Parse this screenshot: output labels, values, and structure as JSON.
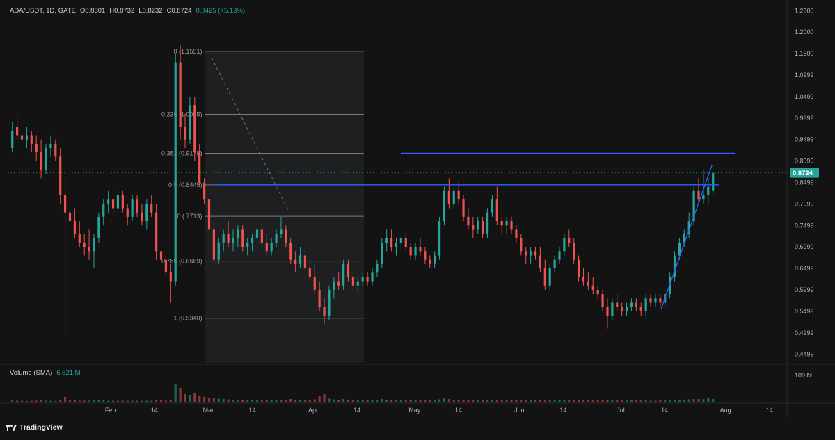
{
  "header": {
    "symbol": "ADA/USDT, 1D, GATE",
    "open": "O0.8301",
    "high": "H0.8732",
    "low": "L0.8232",
    "close": "C0.8724",
    "change": "0.0425 (+5.13%)"
  },
  "volume_panel": {
    "title": "Volume (SMA)",
    "value": "6.621 M",
    "axis_label": "100 M"
  },
  "brand": "TradingView",
  "colors": {
    "up": "#26a69a",
    "down": "#ef5350",
    "line": "#2962ff",
    "fib": "#7a7a7a",
    "badge": "#26a69a"
  },
  "chart_data": {
    "type": "candlestick",
    "price_axis_ticks": [
      "1.2500",
      "1.2000",
      "1.1500",
      "1.0999",
      "1.0499",
      "0.9999",
      "0.9499",
      "0.8999",
      "0.8499",
      "0.7999",
      "0.7499",
      "0.6999",
      "0.6499",
      "0.5999",
      "0.5499",
      "0.4999",
      "0.4499"
    ],
    "ylim": [
      0.43,
      1.265
    ],
    "time_axis_ticks": [
      "Feb",
      "14",
      "Mar",
      "14",
      "Apr",
      "14",
      "May",
      "14",
      "Jun",
      "14",
      "Jul",
      "14",
      "Aug",
      "14"
    ],
    "time_axis_days": [
      31,
      44,
      60,
      73,
      91,
      104,
      121,
      134,
      152,
      165,
      182,
      195,
      213,
      226
    ],
    "xlim": [
      0,
      231
    ],
    "last_price": "0.8724",
    "last_price_value": 0.8724,
    "fib_levels": [
      {
        "label": "0 (1.1551)",
        "value": 1.1551
      },
      {
        "label": "0.236 (1.0085)",
        "value": 1.0085
      },
      {
        "label": "0.382 (0.9178)",
        "value": 0.9178
      },
      {
        "label": "0.5 (0.8445)",
        "value": 0.8445
      },
      {
        "label": "0.(.7713)",
        "value": 0.7713
      },
      {
        "label": "0.786 (0.6669)",
        "value": 0.6669
      },
      {
        "label": "1 (0.5340)",
        "value": 0.534
      }
    ],
    "fib_range_days": [
      59,
      106
    ],
    "fib_diagonal": {
      "from": [
        61,
        1.14
      ],
      "to": [
        84,
        0.78
      ]
    },
    "trend_lines": [
      {
        "from": [
          62,
          0.8445
        ],
        "to": [
          211,
          0.8445
        ]
      },
      {
        "from": [
          117,
          0.918
        ],
        "to": [
          216,
          0.918
        ]
      },
      {
        "from": [
          194,
          0.556
        ],
        "to": [
          209,
          0.89
        ]
      }
    ],
    "ohlc": [
      [
        0.93,
        0.99,
        0.92,
        0.97
      ],
      [
        0.98,
        1.01,
        0.95,
        0.96
      ],
      [
        0.96,
        0.99,
        0.94,
        0.95
      ],
      [
        0.95,
        0.98,
        0.93,
        0.96
      ],
      [
        0.96,
        0.97,
        0.92,
        0.94
      ],
      [
        0.94,
        0.96,
        0.9,
        0.92
      ],
      [
        0.92,
        0.95,
        0.86,
        0.88
      ],
      [
        0.88,
        0.94,
        0.87,
        0.93
      ],
      [
        0.93,
        0.96,
        0.91,
        0.94
      ],
      [
        0.94,
        0.95,
        0.9,
        0.91
      ],
      [
        0.91,
        0.93,
        0.8,
        0.82
      ],
      [
        0.82,
        0.86,
        0.5,
        0.78
      ],
      [
        0.78,
        0.83,
        0.74,
        0.76
      ],
      [
        0.76,
        0.79,
        0.72,
        0.73
      ],
      [
        0.73,
        0.76,
        0.7,
        0.71
      ],
      [
        0.71,
        0.73,
        0.68,
        0.7
      ],
      [
        0.7,
        0.74,
        0.67,
        0.69
      ],
      [
        0.69,
        0.73,
        0.65,
        0.72
      ],
      [
        0.72,
        0.78,
        0.71,
        0.77
      ],
      [
        0.77,
        0.81,
        0.75,
        0.8
      ],
      [
        0.8,
        0.83,
        0.78,
        0.81
      ],
      [
        0.81,
        0.82,
        0.77,
        0.79
      ],
      [
        0.79,
        0.83,
        0.78,
        0.82
      ],
      [
        0.82,
        0.83,
        0.78,
        0.79
      ],
      [
        0.79,
        0.8,
        0.75,
        0.77
      ],
      [
        0.77,
        0.82,
        0.76,
        0.81
      ],
      [
        0.81,
        0.82,
        0.77,
        0.78
      ],
      [
        0.78,
        0.8,
        0.75,
        0.76
      ],
      [
        0.76,
        0.81,
        0.74,
        0.8
      ],
      [
        0.8,
        0.82,
        0.77,
        0.78
      ],
      [
        0.78,
        0.8,
        0.67,
        0.69
      ],
      [
        0.69,
        0.71,
        0.65,
        0.67
      ],
      [
        0.67,
        0.68,
        0.63,
        0.64
      ],
      [
        0.64,
        0.66,
        0.57,
        0.62
      ],
      [
        0.62,
        1.15,
        0.61,
        1.13
      ],
      [
        1.13,
        1.17,
        0.95,
        0.98
      ],
      [
        0.98,
        1.01,
        0.93,
        0.95
      ],
      [
        0.95,
        1.05,
        0.94,
        1.03
      ],
      [
        1.03,
        1.05,
        0.9,
        0.92
      ],
      [
        0.92,
        0.94,
        0.84,
        0.85
      ],
      [
        0.85,
        0.86,
        0.8,
        0.81
      ],
      [
        0.81,
        0.83,
        0.73,
        0.74
      ],
      [
        0.74,
        0.76,
        0.66,
        0.67
      ],
      [
        0.67,
        0.72,
        0.66,
        0.71
      ],
      [
        0.71,
        0.74,
        0.69,
        0.73
      ],
      [
        0.73,
        0.76,
        0.7,
        0.71
      ],
      [
        0.71,
        0.74,
        0.69,
        0.72
      ],
      [
        0.72,
        0.75,
        0.7,
        0.74
      ],
      [
        0.74,
        0.75,
        0.69,
        0.7
      ],
      [
        0.7,
        0.72,
        0.68,
        0.71
      ],
      [
        0.71,
        0.73,
        0.69,
        0.72
      ],
      [
        0.72,
        0.75,
        0.71,
        0.74
      ],
      [
        0.74,
        0.76,
        0.7,
        0.71
      ],
      [
        0.71,
        0.73,
        0.68,
        0.69
      ],
      [
        0.69,
        0.72,
        0.68,
        0.71
      ],
      [
        0.71,
        0.74,
        0.7,
        0.73
      ],
      [
        0.73,
        0.77,
        0.72,
        0.74
      ],
      [
        0.74,
        0.75,
        0.7,
        0.71
      ],
      [
        0.71,
        0.72,
        0.66,
        0.67
      ],
      [
        0.67,
        0.69,
        0.64,
        0.66
      ],
      [
        0.66,
        0.7,
        0.65,
        0.68
      ],
      [
        0.68,
        0.7,
        0.64,
        0.65
      ],
      [
        0.65,
        0.67,
        0.62,
        0.63
      ],
      [
        0.63,
        0.66,
        0.59,
        0.6
      ],
      [
        0.6,
        0.62,
        0.55,
        0.56
      ],
      [
        0.56,
        0.58,
        0.52,
        0.54
      ],
      [
        0.54,
        0.61,
        0.53,
        0.6
      ],
      [
        0.6,
        0.63,
        0.58,
        0.62
      ],
      [
        0.62,
        0.64,
        0.6,
        0.61
      ],
      [
        0.61,
        0.67,
        0.6,
        0.66
      ],
      [
        0.66,
        0.67,
        0.62,
        0.63
      ],
      [
        0.63,
        0.64,
        0.6,
        0.61
      ],
      [
        0.61,
        0.63,
        0.59,
        0.62
      ],
      [
        0.62,
        0.64,
        0.61,
        0.63
      ],
      [
        0.63,
        0.64,
        0.61,
        0.62
      ],
      [
        0.62,
        0.65,
        0.61,
        0.64
      ],
      [
        0.64,
        0.67,
        0.63,
        0.66
      ],
      [
        0.66,
        0.72,
        0.65,
        0.71
      ],
      [
        0.71,
        0.74,
        0.69,
        0.72
      ],
      [
        0.72,
        0.74,
        0.69,
        0.7
      ],
      [
        0.7,
        0.72,
        0.68,
        0.71
      ],
      [
        0.71,
        0.73,
        0.69,
        0.72
      ],
      [
        0.72,
        0.73,
        0.69,
        0.7
      ],
      [
        0.7,
        0.71,
        0.67,
        0.68
      ],
      [
        0.68,
        0.71,
        0.67,
        0.7
      ],
      [
        0.7,
        0.72,
        0.68,
        0.69
      ],
      [
        0.69,
        0.7,
        0.66,
        0.67
      ],
      [
        0.67,
        0.68,
        0.65,
        0.66
      ],
      [
        0.66,
        0.69,
        0.65,
        0.68
      ],
      [
        0.68,
        0.77,
        0.67,
        0.76
      ],
      [
        0.76,
        0.84,
        0.75,
        0.83
      ],
      [
        0.83,
        0.86,
        0.79,
        0.8
      ],
      [
        0.8,
        0.84,
        0.79,
        0.83
      ],
      [
        0.83,
        0.85,
        0.8,
        0.81
      ],
      [
        0.81,
        0.82,
        0.76,
        0.77
      ],
      [
        0.77,
        0.79,
        0.74,
        0.75
      ],
      [
        0.75,
        0.77,
        0.72,
        0.74
      ],
      [
        0.74,
        0.77,
        0.73,
        0.76
      ],
      [
        0.76,
        0.77,
        0.72,
        0.73
      ],
      [
        0.73,
        0.79,
        0.72,
        0.78
      ],
      [
        0.78,
        0.82,
        0.77,
        0.81
      ],
      [
        0.81,
        0.84,
        0.75,
        0.76
      ],
      [
        0.76,
        0.77,
        0.73,
        0.75
      ],
      [
        0.75,
        0.77,
        0.73,
        0.76
      ],
      [
        0.76,
        0.77,
        0.73,
        0.74
      ],
      [
        0.74,
        0.75,
        0.71,
        0.72
      ],
      [
        0.72,
        0.73,
        0.68,
        0.69
      ],
      [
        0.69,
        0.7,
        0.66,
        0.68
      ],
      [
        0.68,
        0.7,
        0.66,
        0.69
      ],
      [
        0.69,
        0.7,
        0.67,
        0.68
      ],
      [
        0.68,
        0.7,
        0.64,
        0.65
      ],
      [
        0.65,
        0.67,
        0.6,
        0.61
      ],
      [
        0.61,
        0.66,
        0.6,
        0.65
      ],
      [
        0.65,
        0.68,
        0.64,
        0.67
      ],
      [
        0.67,
        0.7,
        0.66,
        0.69
      ],
      [
        0.69,
        0.73,
        0.68,
        0.72
      ],
      [
        0.72,
        0.74,
        0.7,
        0.71
      ],
      [
        0.71,
        0.72,
        0.66,
        0.67
      ],
      [
        0.67,
        0.68,
        0.62,
        0.63
      ],
      [
        0.63,
        0.65,
        0.61,
        0.62
      ],
      [
        0.62,
        0.64,
        0.6,
        0.61
      ],
      [
        0.61,
        0.63,
        0.59,
        0.6
      ],
      [
        0.6,
        0.61,
        0.58,
        0.59
      ],
      [
        0.59,
        0.6,
        0.55,
        0.56
      ],
      [
        0.56,
        0.58,
        0.51,
        0.54
      ],
      [
        0.54,
        0.58,
        0.53,
        0.57
      ],
      [
        0.57,
        0.59,
        0.55,
        0.56
      ],
      [
        0.56,
        0.57,
        0.54,
        0.55
      ],
      [
        0.55,
        0.57,
        0.54,
        0.56
      ],
      [
        0.56,
        0.58,
        0.55,
        0.57
      ],
      [
        0.57,
        0.58,
        0.55,
        0.56
      ],
      [
        0.56,
        0.57,
        0.54,
        0.55
      ],
      [
        0.55,
        0.59,
        0.54,
        0.58
      ],
      [
        0.58,
        0.59,
        0.56,
        0.57
      ],
      [
        0.57,
        0.59,
        0.56,
        0.58
      ],
      [
        0.58,
        0.59,
        0.56,
        0.57
      ],
      [
        0.57,
        0.6,
        0.56,
        0.59
      ],
      [
        0.59,
        0.64,
        0.58,
        0.63
      ],
      [
        0.63,
        0.69,
        0.62,
        0.68
      ],
      [
        0.68,
        0.72,
        0.67,
        0.71
      ],
      [
        0.71,
        0.74,
        0.7,
        0.73
      ],
      [
        0.73,
        0.78,
        0.72,
        0.76
      ],
      [
        0.76,
        0.84,
        0.75,
        0.83
      ],
      [
        0.83,
        0.86,
        0.8,
        0.81
      ],
      [
        0.81,
        0.88,
        0.8,
        0.82
      ],
      [
        0.82,
        0.86,
        0.8,
        0.84
      ],
      [
        0.8301,
        0.8732,
        0.8232,
        0.8724
      ]
    ],
    "ohlc_start_day": 2,
    "ohlc_step_days": 1.42,
    "volume_scale_max": 100,
    "volume": [
      4,
      3,
      3,
      2,
      3,
      3,
      4,
      3,
      3,
      2,
      5,
      14,
      6,
      4,
      3,
      3,
      3,
      4,
      5,
      4,
      3,
      3,
      3,
      3,
      3,
      3,
      3,
      3,
      3,
      3,
      5,
      4,
      3,
      4,
      50,
      40,
      22,
      20,
      25,
      16,
      14,
      10,
      12,
      9,
      8,
      7,
      6,
      5,
      5,
      5,
      5,
      6,
      5,
      5,
      4,
      4,
      5,
      5,
      8,
      6,
      5,
      5,
      6,
      7,
      18,
      22,
      9,
      7,
      6,
      8,
      6,
      5,
      5,
      4,
      4,
      4,
      5,
      8,
      6,
      5,
      5,
      5,
      5,
      4,
      4,
      4,
      4,
      4,
      4,
      7,
      12,
      8,
      6,
      5,
      5,
      6,
      5,
      4,
      4,
      4,
      5,
      6,
      5,
      4,
      4,
      4,
      4,
      4,
      4,
      4,
      5,
      6,
      4,
      4,
      4,
      5,
      4,
      5,
      5,
      4,
      4,
      4,
      4,
      4,
      5,
      4,
      4,
      4,
      4,
      4,
      4,
      4,
      4,
      3,
      3,
      4,
      4,
      4,
      4,
      5,
      6,
      7,
      8,
      8,
      8,
      10,
      8
    ]
  }
}
